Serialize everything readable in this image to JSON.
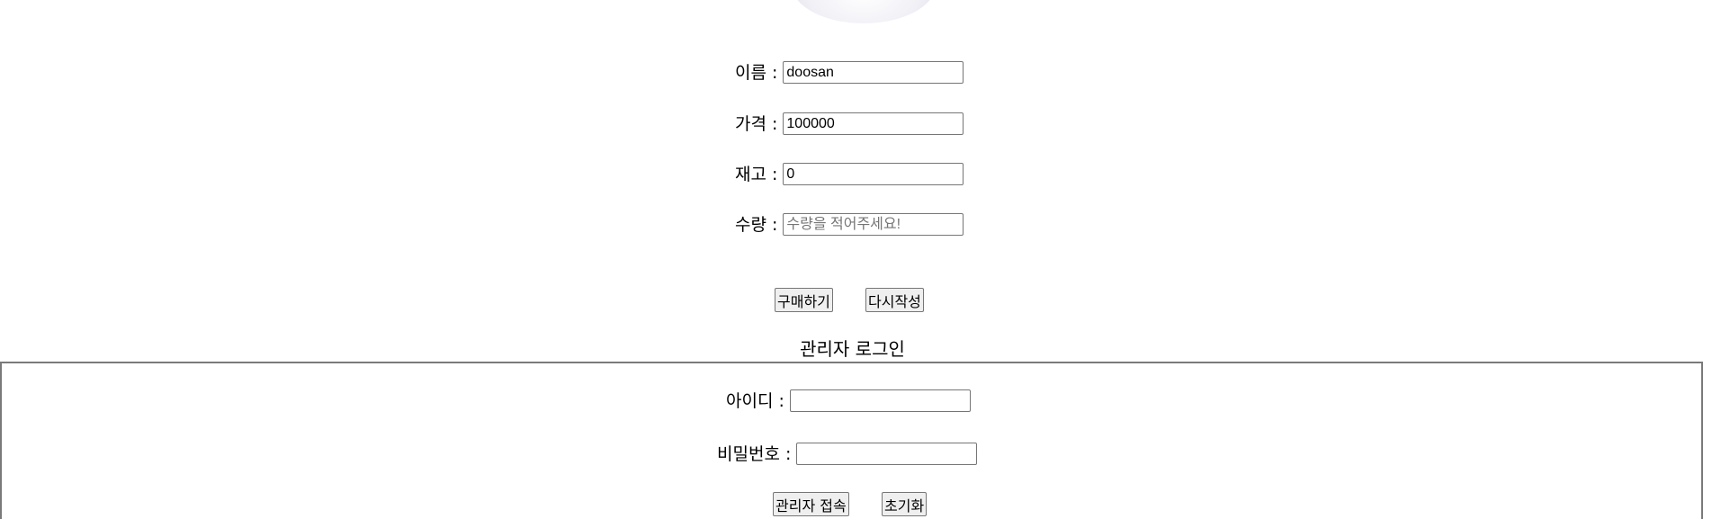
{
  "product_form": {
    "name_label": "이름 :",
    "name_value": "doosan",
    "price_label": "가격 :",
    "price_value": "100000",
    "stock_label": "재고 :",
    "stock_value": "0",
    "quantity_label": "수량 :",
    "quantity_value": "",
    "quantity_placeholder": "수량을 적어주세요!",
    "buy_button": "구매하기",
    "reset_button": "다시작성"
  },
  "admin_login": {
    "title": "관리자 로그인",
    "id_label": "아이디 :",
    "id_value": "",
    "password_label": "비밀번호 :",
    "password_value": "",
    "login_button": "관리자 접속",
    "reset_button": "초기화"
  }
}
